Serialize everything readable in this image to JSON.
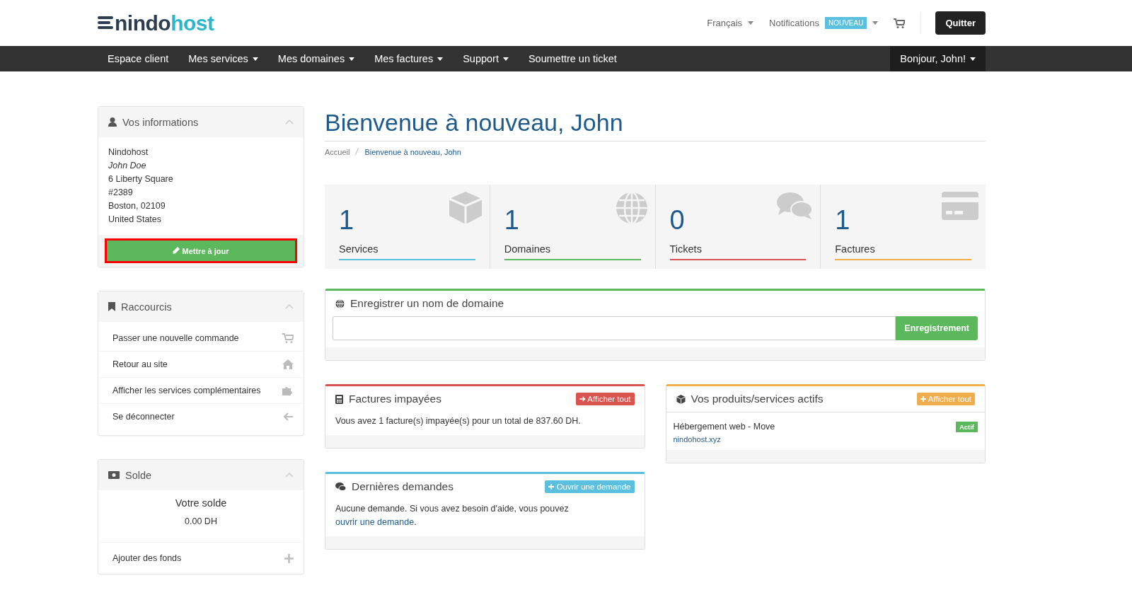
{
  "logo": {
    "prefix": "nindo",
    "suffix": "host"
  },
  "topbar": {
    "language": "Français",
    "notifications": "Notifications",
    "notifications_badge": "NOUVEAU",
    "logout": "Quitter"
  },
  "nav": {
    "items": [
      "Espace client",
      "Mes services",
      "Mes domaines",
      "Mes factures",
      "Support",
      "Soumettre un ticket"
    ],
    "dropdowns": [
      false,
      true,
      true,
      true,
      true,
      false
    ],
    "greeting": "Bonjour, John!"
  },
  "info_panel": {
    "title": "Vos informations",
    "lines": [
      {
        "text": "Nindohost",
        "italic": false
      },
      {
        "text": "John Doe",
        "italic": true
      },
      {
        "text": "6 Liberty Square",
        "italic": false
      },
      {
        "text": "#2389",
        "italic": false
      },
      {
        "text": "Boston, 02109",
        "italic": false
      },
      {
        "text": "United States",
        "italic": false
      }
    ],
    "button": "Mettre à jour",
    "button_highlighted": true
  },
  "shortcuts": {
    "title": "Raccourcis",
    "items": [
      {
        "label": "Passer une nouvelle commande",
        "kind": "cart"
      },
      {
        "label": "Retour au site",
        "kind": "home"
      },
      {
        "label": "Afficher les services complémentaires",
        "kind": "puzzle"
      },
      {
        "label": "Se déconnecter",
        "kind": "arrow"
      }
    ]
  },
  "balance": {
    "title": "Solde",
    "heading": "Votre solde",
    "amount": "0.00 DH",
    "action": "Ajouter des fonds"
  },
  "page_title": "Bienvenue à nouveau, John",
  "breadcrumb": [
    {
      "label": "Accueil",
      "selected": false
    },
    {
      "label": "Bienvenue à nouveau, John",
      "selected": true
    }
  ],
  "stats": [
    {
      "count": "1",
      "label": "Services",
      "color": "#5bc0de",
      "kind": "box"
    },
    {
      "count": "1",
      "label": "Domaines",
      "color": "#5cb85c",
      "kind": "globe"
    },
    {
      "count": "0",
      "label": "Tickets",
      "color": "#d9534f",
      "kind": "chat"
    },
    {
      "count": "1",
      "label": "Factures",
      "color": "#f0ad4e",
      "kind": "card"
    }
  ],
  "domain_panel": {
    "title": "Enregistrer un nom de domaine",
    "button": "Enregistrement"
  },
  "unpaid": {
    "title": "Factures impayées",
    "button": "Afficher tout",
    "text": "Vous avez 1 facture(s) impayée(s) pour un total de 837.60 DH."
  },
  "products": {
    "title": "Vos produits/services actifs",
    "button": "Afficher tout",
    "items": [
      {
        "name": "Hébergement web - Move",
        "domain": "nindohost.xyz",
        "status": "Actif"
      }
    ]
  },
  "tickets": {
    "title": "Dernières demandes",
    "button": "Ouvrir une demande",
    "text": "Aucune demande. Si vous avez besoin d'aide, vous pouvez ",
    "link": "ouvrir une demande",
    "after": "."
  }
}
